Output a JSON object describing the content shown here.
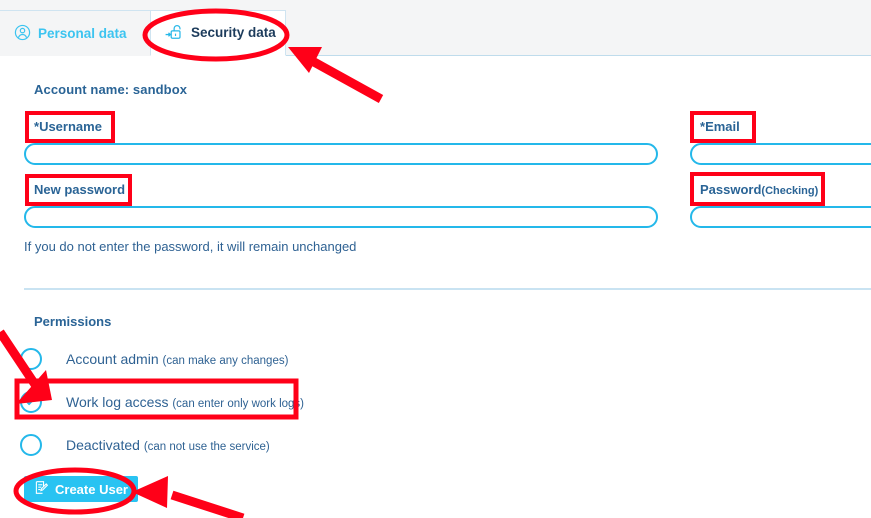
{
  "tabs": [
    {
      "label": "Personal data",
      "icon": "user-circle-icon",
      "active": false
    },
    {
      "label": "Security data",
      "icon": "unlock-icon",
      "active": true
    }
  ],
  "form": {
    "account_name": "Account name: sandbox",
    "username": {
      "label": "Username",
      "required_marker": "*",
      "value": "",
      "placeholder": ""
    },
    "email": {
      "label": "Email",
      "required_marker": "*",
      "value": "",
      "placeholder": ""
    },
    "new_password": {
      "label": "New password",
      "value": "",
      "placeholder": ""
    },
    "password_checking": {
      "label": "Password",
      "note": "(Checking)",
      "value": "",
      "placeholder": ""
    },
    "password_hint": "If you do not enter the password, it will remain unchanged"
  },
  "permissions": {
    "title": "Permissions",
    "options": [
      {
        "name": "Account admin",
        "desc": "(can make any changes)",
        "checked": false
      },
      {
        "name": "Work log access",
        "desc": "(can enter only work logs)",
        "checked": true
      },
      {
        "name": "Deactivated",
        "desc": "(can not use the service)",
        "checked": false
      }
    ]
  },
  "actions": {
    "create_user": {
      "label": "Create User",
      "icon": "form-edit-icon"
    }
  },
  "colors": {
    "accent_cyan": "#24b8ea",
    "button_cyan": "#29c3f2",
    "text_blue": "#2f6293",
    "active_tab_text": "#1d3c5c",
    "annotation_red": "#ff0018",
    "divider": "#c9e3f2",
    "strip_bg": "#f4f5f6"
  }
}
